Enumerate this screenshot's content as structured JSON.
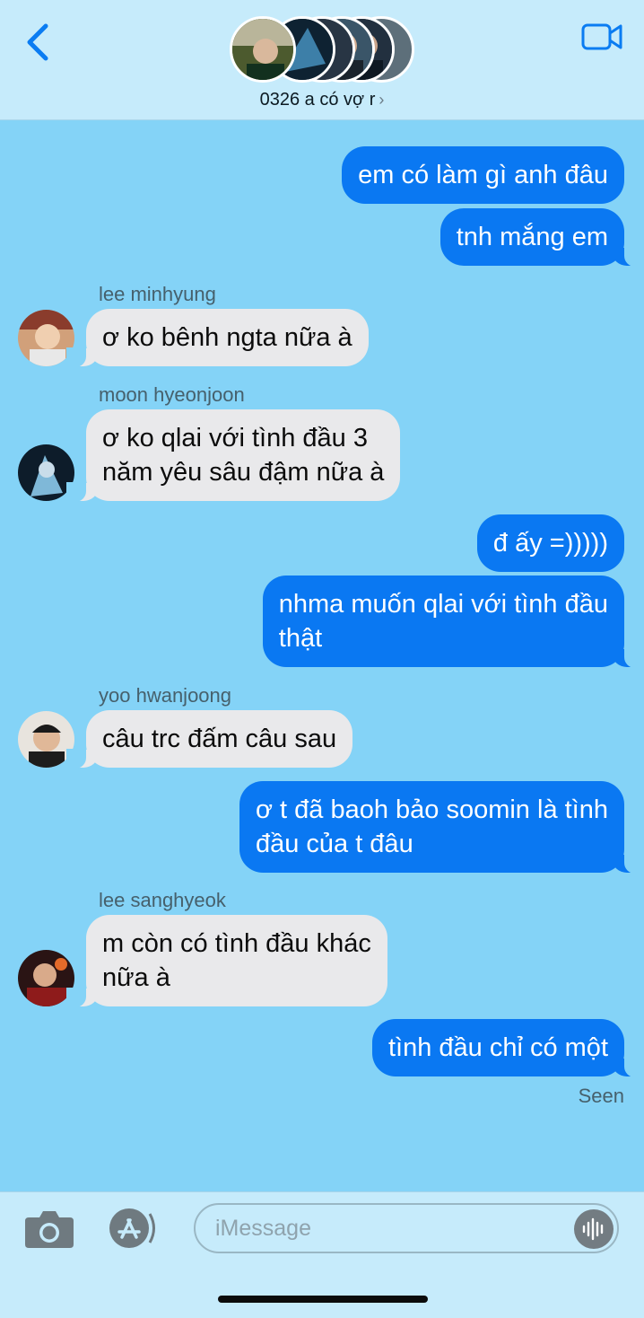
{
  "header": {
    "group_name": "0326 a có vợ r",
    "chevron": "›",
    "back_icon": "chevron-left-icon",
    "video_icon": "video-camera-icon"
  },
  "colors": {
    "background": "#84d3f7",
    "bar": "#c6ebfb",
    "outgoing_bubble": "#0a78f2",
    "incoming_bubble": "#e9e9eb",
    "sender_name": "#46606c"
  },
  "messages": [
    {
      "direction": "out",
      "text": "em có làm gì anh đâu"
    },
    {
      "direction": "out",
      "text": "tnh mắng em"
    },
    {
      "direction": "in",
      "sender": "lee minhyung",
      "text": "ơ ko bênh ngta nữa à"
    },
    {
      "direction": "in",
      "sender": "moon hyeonjoon",
      "lines": [
        "ơ ko qlai với tình đầu 3",
        "năm yêu sâu đậm nữa à"
      ]
    },
    {
      "direction": "out",
      "text": "đ ấy =)))))"
    },
    {
      "direction": "out",
      "lines": [
        "nhma muốn qlai với tình đầu",
        "thật"
      ]
    },
    {
      "direction": "in",
      "sender": "yoo hwanjoong",
      "text": "câu trc đấm câu sau"
    },
    {
      "direction": "out",
      "lines": [
        "ơ t đã baoh bảo soomin là tình",
        "đầu của t đâu"
      ]
    },
    {
      "direction": "in",
      "sender": "lee sanghyeok",
      "lines": [
        "m còn có tình đầu khác",
        "nữa à"
      ]
    },
    {
      "direction": "out",
      "text": "tình đầu chỉ có một"
    }
  ],
  "status": {
    "seen": "Seen"
  },
  "input": {
    "placeholder": "iMessage",
    "camera_icon": "camera-icon",
    "appstore_icon": "app-store-icon",
    "audio_icon": "audio-waveform-icon"
  }
}
